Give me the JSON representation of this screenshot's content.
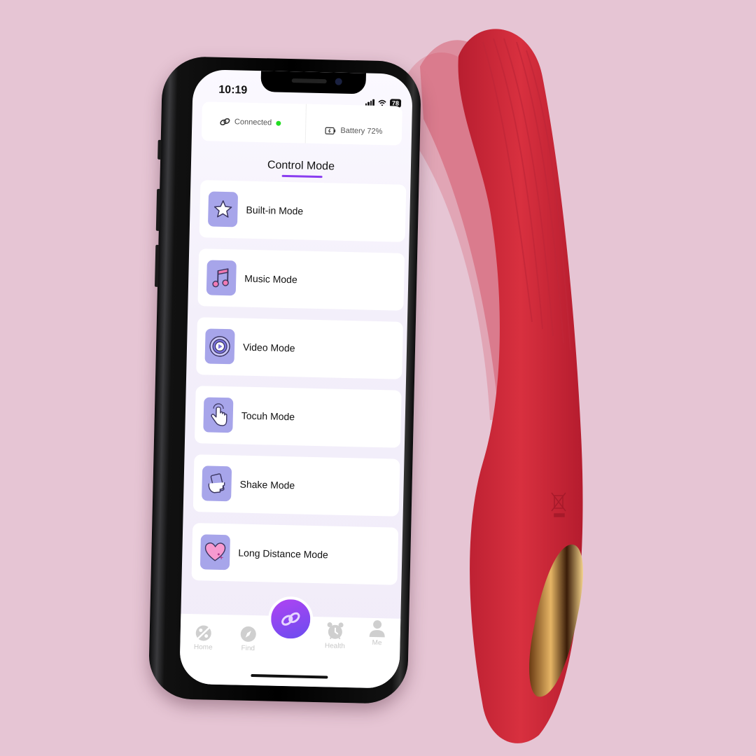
{
  "colors": {
    "background": "#e6c5d4",
    "accent": "#8a3df0",
    "icon_tile": "#a7a5ea",
    "connected_dot": "#22dd22",
    "product_red": "#d02a3c",
    "gold": "#c99a3c"
  },
  "status_bar": {
    "time": "10:19",
    "battery_badge": "78",
    "icons": [
      "signal-icon",
      "wifi-icon",
      "battery-icon"
    ]
  },
  "connection": {
    "connected_label": "Connected",
    "connected_icon": "link-icon",
    "battery_label": "Battery 72%",
    "battery_icon": "battery-charging-icon"
  },
  "page": {
    "title": "Control Mode"
  },
  "modes": [
    {
      "label": "Built-in Mode",
      "icon": "star-icon"
    },
    {
      "label": "Music Mode",
      "icon": "music-note-icon"
    },
    {
      "label": "Video Mode",
      "icon": "video-play-icon"
    },
    {
      "label": "Tocuh Mode",
      "icon": "touch-hand-icon"
    },
    {
      "label": "Shake Mode",
      "icon": "shake-phone-icon"
    },
    {
      "label": "Long Distance Mode",
      "icon": "heart-icon"
    }
  ],
  "tabbar": {
    "items": [
      {
        "label": "Home",
        "icon": "planet-icon"
      },
      {
        "label": "Find",
        "icon": "compass-icon"
      },
      {
        "label": "",
        "icon": "link-icon"
      },
      {
        "label": "Health",
        "icon": "alarm-clock-icon"
      },
      {
        "label": "Me",
        "icon": "person-icon"
      }
    ]
  }
}
